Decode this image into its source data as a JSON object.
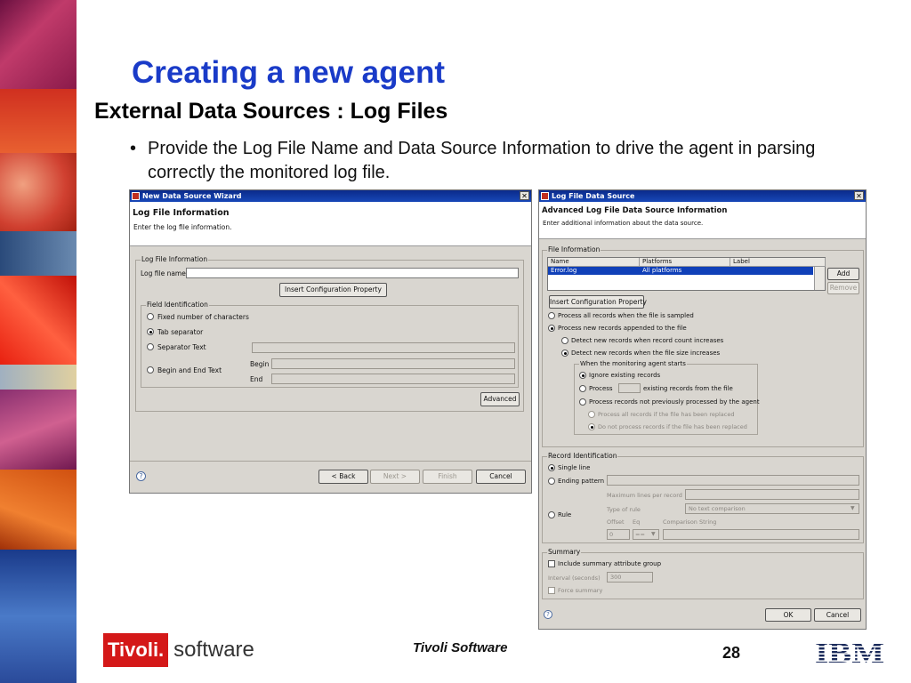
{
  "slide": {
    "title": "Creating a new agent",
    "subtitle": "External Data Sources : Log Files",
    "bullet": "Provide the Log File Name and Data Source Information to drive the agent in parsing correctly the monitored log file.",
    "bullet_marker": "•"
  },
  "wizard": {
    "title": "New Data Source Wizard",
    "close_glyph": "✕",
    "header_title": "Log File Information",
    "header_desc": "Enter the log file information.",
    "group_log": "Log File Information",
    "log_file_name_label": "Log file name",
    "log_file_name_value": "",
    "insert_config_label": "Insert Configuration Property",
    "group_field_id": "Field Identification",
    "opt_fixed": "Fixed number of characters",
    "opt_tab": "Tab separator",
    "opt_sep_text": "Separator Text",
    "opt_begin_end": "Begin and End Text",
    "begin_label": "Begin",
    "end_label": "End",
    "advanced_label": "Advanced",
    "help_glyph": "?",
    "back_label": "< Back",
    "next_label": "Next >",
    "finish_label": "Finish",
    "cancel_label": "Cancel"
  },
  "adv": {
    "title": "Log File Data Source",
    "close_glyph": "✕",
    "header_title": "Advanced Log File Data Source Information",
    "header_desc": "Enter additional information about the data source.",
    "group_file_info": "File Information",
    "table": {
      "columns": [
        "Name",
        "Platforms",
        "Label"
      ],
      "rows": [
        [
          "Error.log",
          "All platforms",
          ""
        ]
      ]
    },
    "add_label": "Add",
    "remove_label": "Remove",
    "insert_config_label": "Insert Configuration Property",
    "opt_process_all": "Process all records when the file is sampled",
    "opt_process_new": "Process new records appended to the file",
    "opt_detect_count": "Detect new records when record count increases",
    "opt_detect_size": "Detect new records when the file size increases",
    "group_monitor_start": "When the monitoring agent starts",
    "opt_ignore": "Ignore existing records",
    "opt_process_prefix": "Process",
    "opt_process_suffix": "existing records from the file",
    "opt_not_processed": "Process records not previously processed by the agent",
    "opt_all_replaced": "Process all records if the file has been replaced",
    "opt_not_replaced": "Do not process records if the file has been replaced",
    "group_record_id": "Record Identification",
    "opt_single_line": "Single line",
    "opt_ending_pattern": "Ending pattern",
    "max_lines_label": "Maximum lines per record",
    "type_rule_label": "Type of rule",
    "type_rule_value": "No text comparison",
    "opt_rule": "Rule",
    "offset_label": "Offset",
    "eq_label": "Eq",
    "comparison_label": "Comparison String",
    "offset_value": "0",
    "eq_value": "==",
    "group_summary": "Summary",
    "include_summary": "Include summary attribute group",
    "interval_label": "Interval (seconds)",
    "interval_value": "300",
    "force_summary": "Force summary",
    "help_glyph": "?",
    "ok_label": "OK",
    "cancel_label": "Cancel"
  },
  "footer": {
    "brand_tivoli": "Tivoli.",
    "brand_software": "software",
    "center": "Tivoli Software",
    "page": "28",
    "ibm": "IBM"
  }
}
